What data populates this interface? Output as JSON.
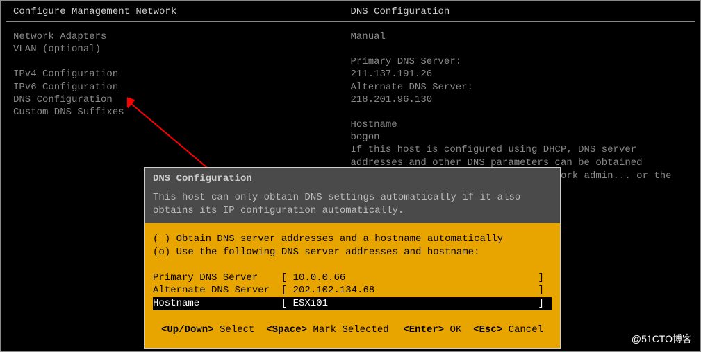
{
  "header": {
    "left": "Configure Management Network",
    "right": "DNS Configuration"
  },
  "menu": {
    "items": [
      "Network Adapters",
      "VLAN (optional)",
      "IPv4 Configuration",
      "IPv6 Configuration",
      "DNS Configuration",
      "Custom DNS Suffixes"
    ]
  },
  "info": {
    "mode": "Manual",
    "primary_label": "Primary DNS Server:",
    "primary_value": "211.137.191.26",
    "alternate_label": "Alternate DNS Server:",
    "alternate_value": "218.201.96.130",
    "hostname_label": "Hostname",
    "hostname_value": "bogon",
    "paragraph": "If this host is configured using DHCP, DNS server addresses and other DNS parameters can be obtained automatically. If not, ask your network admin... or the appropriate"
  },
  "dialog": {
    "title": "DNS Configuration",
    "subtitle": "This host can only obtain DNS settings automatically if it also obtains its IP configuration automatically.",
    "radios": {
      "auto": "( ) Obtain DNS server addresses and a hostname automatically",
      "manual": "(o) Use the following DNS server addresses and hostname:"
    },
    "fields": {
      "primary": "Primary DNS Server    [ 10.0.0.66                                 ]",
      "alternate": "Alternate DNS Server  [ 202.102.134.68                            ]",
      "hostname": "Hostname              [ ESXi01                                    ]"
    },
    "footer": {
      "updown_key": "<Up/Down>",
      "updown_label": " Select  ",
      "space_key": "<Space>",
      "space_label": " Mark Selected",
      "enter_key": "<Enter>",
      "enter_label": " OK  ",
      "esc_key": "<Esc>",
      "esc_label": " Cancel"
    }
  },
  "watermark": "@51CTO博客"
}
